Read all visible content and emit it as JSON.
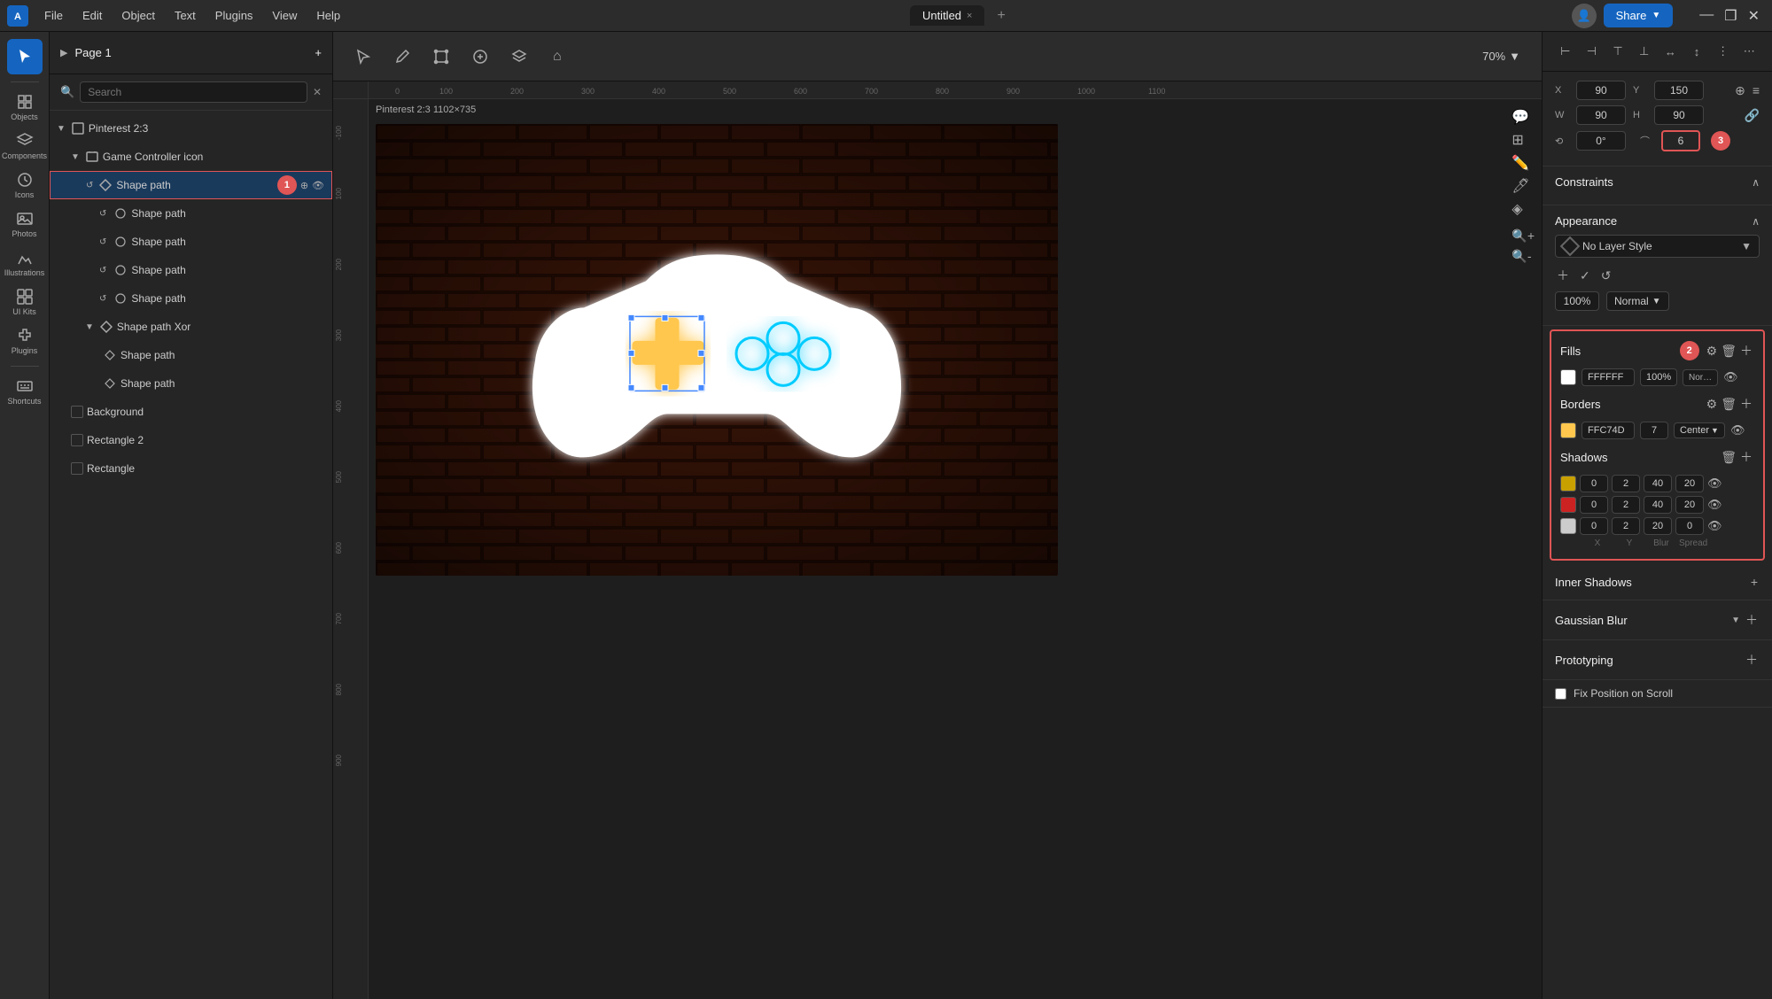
{
  "app": {
    "title": "Untitled",
    "logo": "A",
    "zoom": "70%"
  },
  "titlebar": {
    "menus": [
      "File",
      "Edit",
      "Object",
      "Text",
      "Plugins",
      "View",
      "Help"
    ],
    "tab_name": "Untitled",
    "close_label": "×",
    "newtab_label": "+",
    "share_label": "Share",
    "zoom_label": "70%",
    "minimize": "—",
    "maximize": "❐",
    "close": "✕"
  },
  "left_toolbar": {
    "tools": [
      {
        "name": "select",
        "label": ""
      },
      {
        "name": "frame",
        "label": ""
      },
      {
        "name": "image",
        "label": ""
      },
      {
        "name": "text",
        "label": ""
      },
      {
        "name": "pen",
        "label": ""
      },
      {
        "name": "shape-rect",
        "label": ""
      },
      {
        "name": "shape-circle",
        "label": ""
      },
      {
        "name": "shape-triangle",
        "label": ""
      },
      {
        "name": "component",
        "label": ""
      },
      {
        "name": "avatar-tool",
        "label": ""
      },
      {
        "name": "crop",
        "label": ""
      }
    ]
  },
  "layers_panel": {
    "page_label": "Page 1",
    "search_placeholder": "Search",
    "add_label": "+",
    "items": [
      {
        "id": "pinterest",
        "name": "Pinterest 2:3",
        "type": "frame",
        "indent": 0,
        "expanded": true
      },
      {
        "id": "game-controller",
        "name": "Game Controller icon",
        "type": "group",
        "indent": 1,
        "expanded": true
      },
      {
        "id": "shape-path-1",
        "name": "Shape path",
        "type": "shape",
        "indent": 2,
        "selected": true,
        "badge": "1"
      },
      {
        "id": "shape-path-2",
        "name": "Shape path",
        "type": "shape-sm",
        "indent": 3
      },
      {
        "id": "shape-path-3",
        "name": "Shape path",
        "type": "shape-sm",
        "indent": 3
      },
      {
        "id": "shape-path-4",
        "name": "Shape path",
        "type": "shape-sm",
        "indent": 3
      },
      {
        "id": "shape-path-5",
        "name": "Shape path",
        "type": "shape-sm",
        "indent": 3
      },
      {
        "id": "shape-path-xor",
        "name": "Shape path Xor",
        "type": "shape-xor",
        "indent": 2,
        "expanded": true
      },
      {
        "id": "shape-path-6",
        "name": "Shape path",
        "type": "shape-sm2",
        "indent": 3
      },
      {
        "id": "shape-path-7",
        "name": "Shape path",
        "type": "shape-sm2",
        "indent": 3
      },
      {
        "id": "background",
        "name": "Background",
        "type": "rect",
        "indent": 1
      },
      {
        "id": "rectangle-2",
        "name": "Rectangle 2",
        "type": "rect",
        "indent": 1
      },
      {
        "id": "rectangle",
        "name": "Rectangle",
        "type": "rect",
        "indent": 1
      }
    ]
  },
  "canvas": {
    "frame_label": "Pinterest 2:3  1102×735"
  },
  "right_panel": {
    "coords": {
      "x_label": "X",
      "x_value": "90",
      "y_label": "Y",
      "y_value": "150",
      "w_label": "W",
      "w_value": "90",
      "h_label": "H",
      "h_value": "90",
      "r_label": "°",
      "r_value": "0°",
      "corner_label": "6",
      "badge_3": "3"
    },
    "constraints": {
      "title": "Constraints",
      "expand_label": "∧"
    },
    "appearance": {
      "title": "Appearance",
      "expand_label": "∧",
      "no_layer_style": "No Layer Style",
      "opacity": "100%",
      "blend_mode": "Normal"
    },
    "fills": {
      "title": "Fills",
      "badge": "2",
      "color": "FFFFFF",
      "opacity": "100%",
      "blend": "Nor…"
    },
    "borders": {
      "title": "Borders",
      "color": "FFC74D",
      "width": "7",
      "position": "Center"
    },
    "shadows": {
      "title": "Shadows",
      "items": [
        {
          "color": "#c8a000",
          "x": "0",
          "y": "2",
          "blur": "40",
          "spread": "20"
        },
        {
          "color": "#cc0000",
          "x": "0",
          "y": "2",
          "blur": "40",
          "spread": "20"
        },
        {
          "color": "#cccccc",
          "x": "0",
          "y": "2",
          "blur": "20",
          "spread": "0"
        }
      ],
      "labels": [
        "X",
        "Y",
        "Blur",
        "Spread"
      ]
    },
    "inner_shadows": {
      "title": "Inner Shadows",
      "add_label": "+"
    },
    "gaussian_blur": {
      "title": "Gaussian Blur"
    },
    "prototyping": {
      "title": "Prototyping",
      "fix_position": "Fix Position on Scroll"
    }
  }
}
